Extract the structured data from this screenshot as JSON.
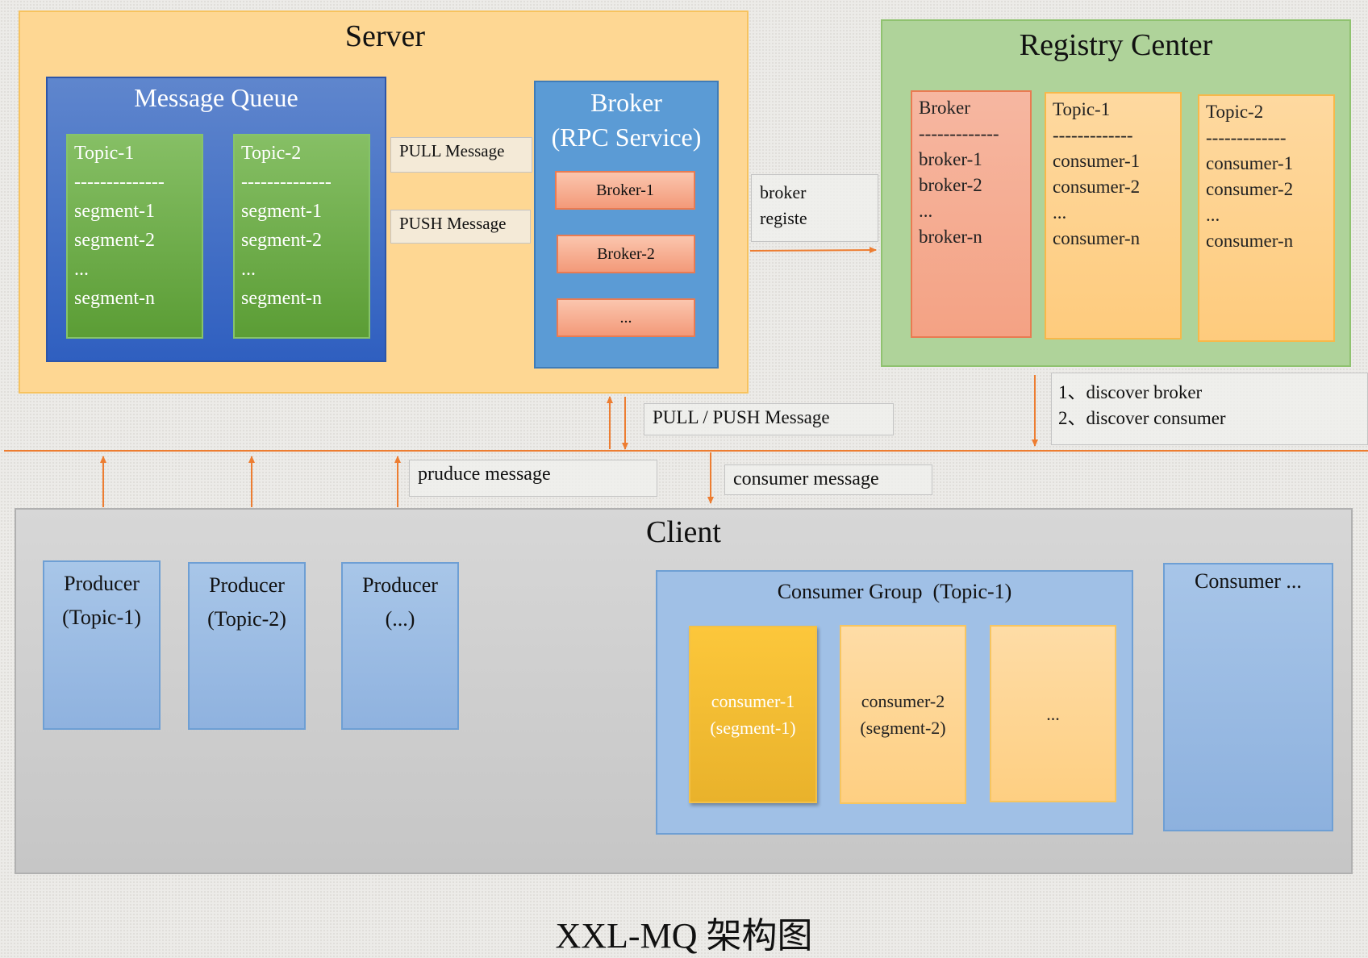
{
  "server": {
    "title": "Server",
    "message_queue": {
      "title": "Message Queue",
      "topics": [
        {
          "name": "Topic-1",
          "divider": "--------------",
          "segments": [
            "segment-1",
            "segment-2",
            "...",
            "segment-n"
          ]
        },
        {
          "name": "Topic-2",
          "divider": "--------------",
          "segments": [
            "segment-1",
            "segment-2",
            "...",
            "segment-n"
          ]
        }
      ]
    },
    "broker": {
      "title_line1": "Broker",
      "title_line2": "(RPC Service)",
      "items": [
        "Broker-1",
        "Broker-2",
        "..."
      ]
    },
    "pull_label": "PULL Message",
    "push_label": "PUSH Message"
  },
  "broker_registe_label": [
    "broker",
    "registe"
  ],
  "registry": {
    "title": "Registry Center",
    "broker_col": {
      "title": "Broker",
      "divider": "-------------",
      "items": [
        "broker-1",
        "broker-2",
        "...",
        "broker-n"
      ]
    },
    "topic_cols": [
      {
        "title": "Topic-1",
        "divider": "-------------",
        "items": [
          "consumer-1",
          "consumer-2",
          "...",
          "consumer-n"
        ]
      },
      {
        "title": "Topic-2",
        "divider": "-------------",
        "items": [
          "consumer-1",
          "consumer-2",
          "...",
          "consumer-n"
        ]
      }
    ]
  },
  "discover_label": [
    "1、discover broker",
    "2、discover consumer"
  ],
  "pull_push_label": "PULL / PUSH Message",
  "produce_label": "pruduce message",
  "consume_label": "consumer message",
  "client": {
    "title": "Client",
    "producers": [
      {
        "line1": "Producer",
        "line2": "(Topic-1)"
      },
      {
        "line1": "Producer",
        "line2": "(Topic-2)"
      },
      {
        "line1": "Producer",
        "line2": "(...)"
      }
    ],
    "consumer_group": {
      "title": "Consumer Group  (Topic-1)",
      "consumers": [
        {
          "line1": "consumer-1",
          "line2": "(segment-1)"
        },
        {
          "line1": "consumer-2",
          "line2": "(segment-2)"
        },
        {
          "line1": "...",
          "line2": ""
        }
      ]
    },
    "consumer_more": "Consumer ..."
  },
  "caption": "XXL-MQ 架构图",
  "colors": {
    "arrow": "#ed7d31"
  }
}
